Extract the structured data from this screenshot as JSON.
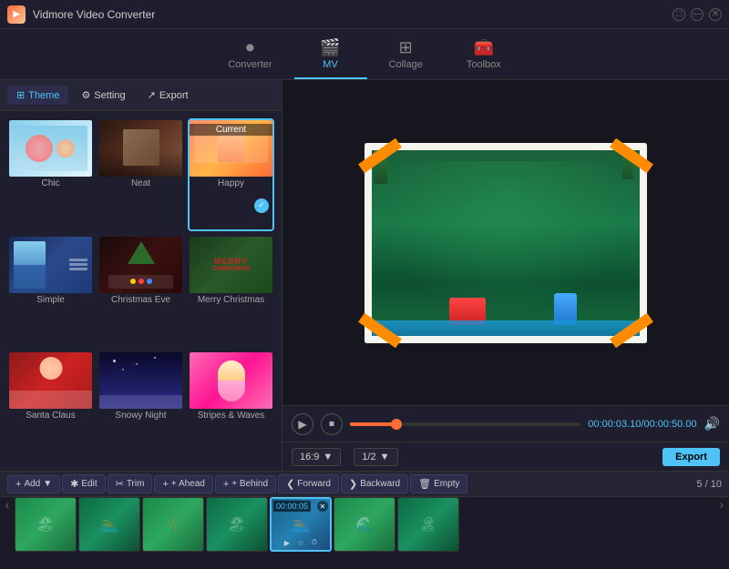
{
  "app": {
    "title": "Vidmore Video Converter",
    "logo": "V"
  },
  "nav": {
    "tabs": [
      {
        "id": "converter",
        "label": "Converter",
        "icon": "⏵",
        "active": false
      },
      {
        "id": "mv",
        "label": "MV",
        "icon": "🎬",
        "active": true
      },
      {
        "id": "collage",
        "label": "Collage",
        "icon": "⊞",
        "active": false
      },
      {
        "id": "toolbox",
        "label": "Toolbox",
        "icon": "🧰",
        "active": false
      }
    ]
  },
  "subnav": {
    "items": [
      {
        "id": "theme",
        "label": "Theme",
        "icon": "⊞",
        "active": true
      },
      {
        "id": "setting",
        "label": "Setting",
        "icon": "⚙",
        "active": false
      },
      {
        "id": "export",
        "label": "Export",
        "icon": "↗",
        "active": false
      }
    ]
  },
  "themes": [
    {
      "id": "chic",
      "label": "Chic",
      "selected": false,
      "current": false
    },
    {
      "id": "neat",
      "label": "Neat",
      "selected": false,
      "current": false
    },
    {
      "id": "happy",
      "label": "Happy",
      "selected": true,
      "current": true,
      "currentLabel": "Current"
    },
    {
      "id": "simple",
      "label": "Simple",
      "selected": false,
      "current": false
    },
    {
      "id": "christmas",
      "label": "Christmas Eve",
      "selected": false,
      "current": false
    },
    {
      "id": "merry",
      "label": "Merry Christmas",
      "selected": false,
      "current": false
    },
    {
      "id": "santa",
      "label": "Santa Claus",
      "selected": false,
      "current": false
    },
    {
      "id": "snowy",
      "label": "Snowy Night",
      "selected": false,
      "current": false
    },
    {
      "id": "stripes",
      "label": "Stripes & Waves",
      "selected": false,
      "current": false
    }
  ],
  "preview": {
    "time_current": "00:00:03.10",
    "time_total": "00:00:50.00",
    "time_display": "00:00:03.10/00:00:50.00",
    "progress_percent": 20
  },
  "controls": {
    "ratio": "16:9",
    "quality": "1/2",
    "export_label": "Export"
  },
  "timeline": {
    "add_label": "+ Add",
    "edit_label": "Edit",
    "trim_label": "Trim",
    "ahead_label": "+ Ahead",
    "behind_label": "+ Behind",
    "forward_label": "Forward",
    "backward_label": "Backward",
    "empty_label": "Empty",
    "page_count": "5 / 10"
  },
  "clips": [
    {
      "id": 1,
      "bg": "beach",
      "selected": false
    },
    {
      "id": 2,
      "bg": "beach2",
      "selected": false
    },
    {
      "id": 3,
      "bg": "beach",
      "selected": false
    },
    {
      "id": 4,
      "bg": "beach2",
      "selected": false
    },
    {
      "id": 5,
      "bg": "pool",
      "selected": true,
      "duration": "00:00:05"
    },
    {
      "id": 6,
      "bg": "beach",
      "selected": false
    },
    {
      "id": 7,
      "bg": "beach2",
      "selected": false
    }
  ]
}
